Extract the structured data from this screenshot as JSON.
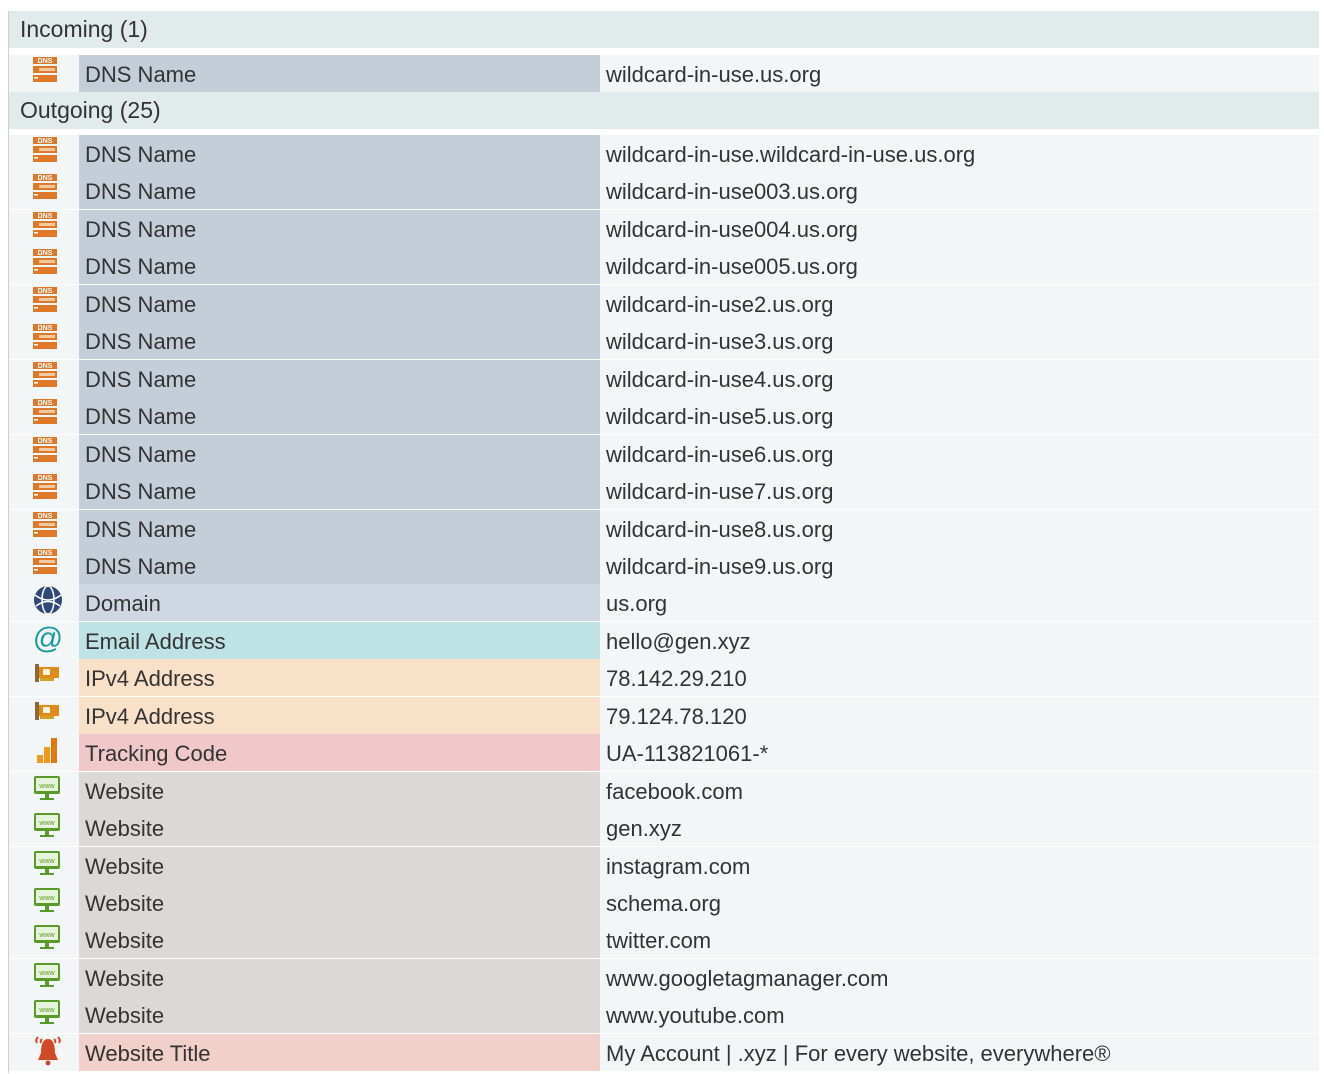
{
  "groups": {
    "incoming": {
      "label": "Incoming (1)"
    },
    "outgoing": {
      "label": "Outgoing (25)"
    }
  },
  "incoming_rows": [
    {
      "type": "DNS Name",
      "value": "wildcard-in-use.us.org",
      "icon": "dns-icon"
    }
  ],
  "outgoing_rows": [
    {
      "type": "DNS Name",
      "value": "wildcard-in-use.wildcard-in-use.us.org",
      "icon": "dns-icon"
    },
    {
      "type": "DNS Name",
      "value": "wildcard-in-use003.us.org",
      "icon": "dns-icon"
    },
    {
      "type": "DNS Name",
      "value": "wildcard-in-use004.us.org",
      "icon": "dns-icon"
    },
    {
      "type": "DNS Name",
      "value": "wildcard-in-use005.us.org",
      "icon": "dns-icon"
    },
    {
      "type": "DNS Name",
      "value": "wildcard-in-use2.us.org",
      "icon": "dns-icon"
    },
    {
      "type": "DNS Name",
      "value": "wildcard-in-use3.us.org",
      "icon": "dns-icon"
    },
    {
      "type": "DNS Name",
      "value": "wildcard-in-use4.us.org",
      "icon": "dns-icon"
    },
    {
      "type": "DNS Name",
      "value": "wildcard-in-use5.us.org",
      "icon": "dns-icon"
    },
    {
      "type": "DNS Name",
      "value": "wildcard-in-use6.us.org",
      "icon": "dns-icon"
    },
    {
      "type": "DNS Name",
      "value": "wildcard-in-use7.us.org",
      "icon": "dns-icon"
    },
    {
      "type": "DNS Name",
      "value": "wildcard-in-use8.us.org",
      "icon": "dns-icon"
    },
    {
      "type": "DNS Name",
      "value": "wildcard-in-use9.us.org",
      "icon": "dns-icon"
    },
    {
      "type": "Domain",
      "value": "us.org",
      "icon": "globe-icon"
    },
    {
      "type": "Email Address",
      "value": "hello@gen.xyz",
      "icon": "at-sign-icon"
    },
    {
      "type": "IPv4 Address",
      "value": "78.142.29.210",
      "icon": "network-card-icon"
    },
    {
      "type": "IPv4 Address",
      "value": "79.124.78.120",
      "icon": "network-card-icon"
    },
    {
      "type": "Tracking Code",
      "value": "UA-113821061-*",
      "icon": "analytics-bars-icon"
    },
    {
      "type": "Website",
      "value": "facebook.com",
      "icon": "www-monitor-icon"
    },
    {
      "type": "Website",
      "value": "gen.xyz",
      "icon": "www-monitor-icon"
    },
    {
      "type": "Website",
      "value": "instagram.com",
      "icon": "www-monitor-icon"
    },
    {
      "type": "Website",
      "value": "schema.org",
      "icon": "www-monitor-icon"
    },
    {
      "type": "Website",
      "value": "twitter.com",
      "icon": "www-monitor-icon"
    },
    {
      "type": "Website",
      "value": "www.googletagmanager.com",
      "icon": "www-monitor-icon"
    },
    {
      "type": "Website",
      "value": "www.youtube.com",
      "icon": "www-monitor-icon"
    },
    {
      "type": "Website Title",
      "value": "My Account | .xyz | For every website, everywhere®",
      "icon": "alarm-bell-icon"
    }
  ],
  "icon_labels": {
    "dns": "DNS",
    "www": "www"
  },
  "colors": {
    "dns_orange": "#e0782a",
    "globe_blue": "#2f4a7a",
    "email_teal": "#1a9aa0",
    "ipv4_orange": "#e08a1a",
    "tracking_orange": "#f29a1e",
    "website_green": "#5a9a2a",
    "title_red": "#d04a2a"
  }
}
